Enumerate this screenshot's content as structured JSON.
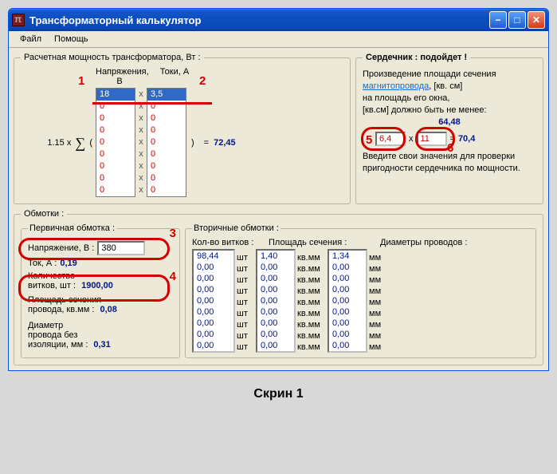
{
  "window": {
    "title": "Трансформаторный калькулятор"
  },
  "menu": {
    "file": "Файл",
    "help": "Помощь"
  },
  "power": {
    "legend": "Расчетная мощность трансформатора, Вт :",
    "col_voltage": "Напряжения, В",
    "col_current": "Токи, А",
    "prefix_const": "1.15",
    "prefix_x": "x",
    "open": "(",
    "close": ")",
    "eq": "=",
    "result": "72,45",
    "voltages": [
      "18",
      "0",
      "0",
      "0",
      "0",
      "0",
      "0",
      "0",
      "0"
    ],
    "currents": [
      "3,5",
      "0",
      "0",
      "0",
      "0",
      "0",
      "0",
      "0",
      "0"
    ],
    "marks": {
      "m1": "1",
      "m2": "2"
    }
  },
  "core": {
    "legend": "Сердечник : подойдет !",
    "line1": "Произведение площади сечения",
    "link": "магнитопровода",
    "line1b": ", [кв. см]",
    "line2": "на площадь его окна,",
    "line3": "[кв.см] должно быть не менее:",
    "need": "64,48",
    "val1": "6,4",
    "val2": "11",
    "eq": "=",
    "result": "70,4",
    "hint": "Введите свои значения для проверки пригодности сердечника по мощности.",
    "marks": {
      "m5": "5",
      "m6": "6"
    }
  },
  "windings": {
    "legend": "Обмотки :",
    "primary": {
      "legend": "Первичная обмотка :",
      "voltage_label": "Напряжение, В :",
      "voltage_value": "380",
      "current_label": "Ток, А :",
      "current_value": "0,19",
      "turns_label_a": "Количество",
      "turns_label_b": "витков, шт :",
      "turns_value": "1900,00",
      "area_label_a": "Площадь сечения",
      "area_label_b": "провода, кв.мм :",
      "area_value": "0,08",
      "dia_label_a": "Диаметр",
      "dia_label_b": "провода без",
      "dia_label_c": "изоляции, мм :",
      "dia_value": "0,31",
      "marks": {
        "m3": "3",
        "m4": "4"
      }
    },
    "secondary": {
      "legend": "Вторичные обмотки :",
      "col_turns": "Кол-во витков :",
      "col_area": "Площадь сечения :",
      "col_dia": "Диаметры проводов :",
      "unit_pcs": "шт",
      "unit_area": "кв.мм",
      "unit_dia": "мм",
      "turns": [
        "98,44",
        "0,00",
        "0,00",
        "0,00",
        "0,00",
        "0,00",
        "0,00",
        "0,00",
        "0,00"
      ],
      "areas": [
        "1,40",
        "0,00",
        "0,00",
        "0,00",
        "0,00",
        "0,00",
        "0,00",
        "0,00",
        "0,00"
      ],
      "dias": [
        "1,34",
        "0,00",
        "0,00",
        "0,00",
        "0,00",
        "0,00",
        "0,00",
        "0,00",
        "0,00"
      ]
    }
  },
  "caption": "Скрин 1"
}
